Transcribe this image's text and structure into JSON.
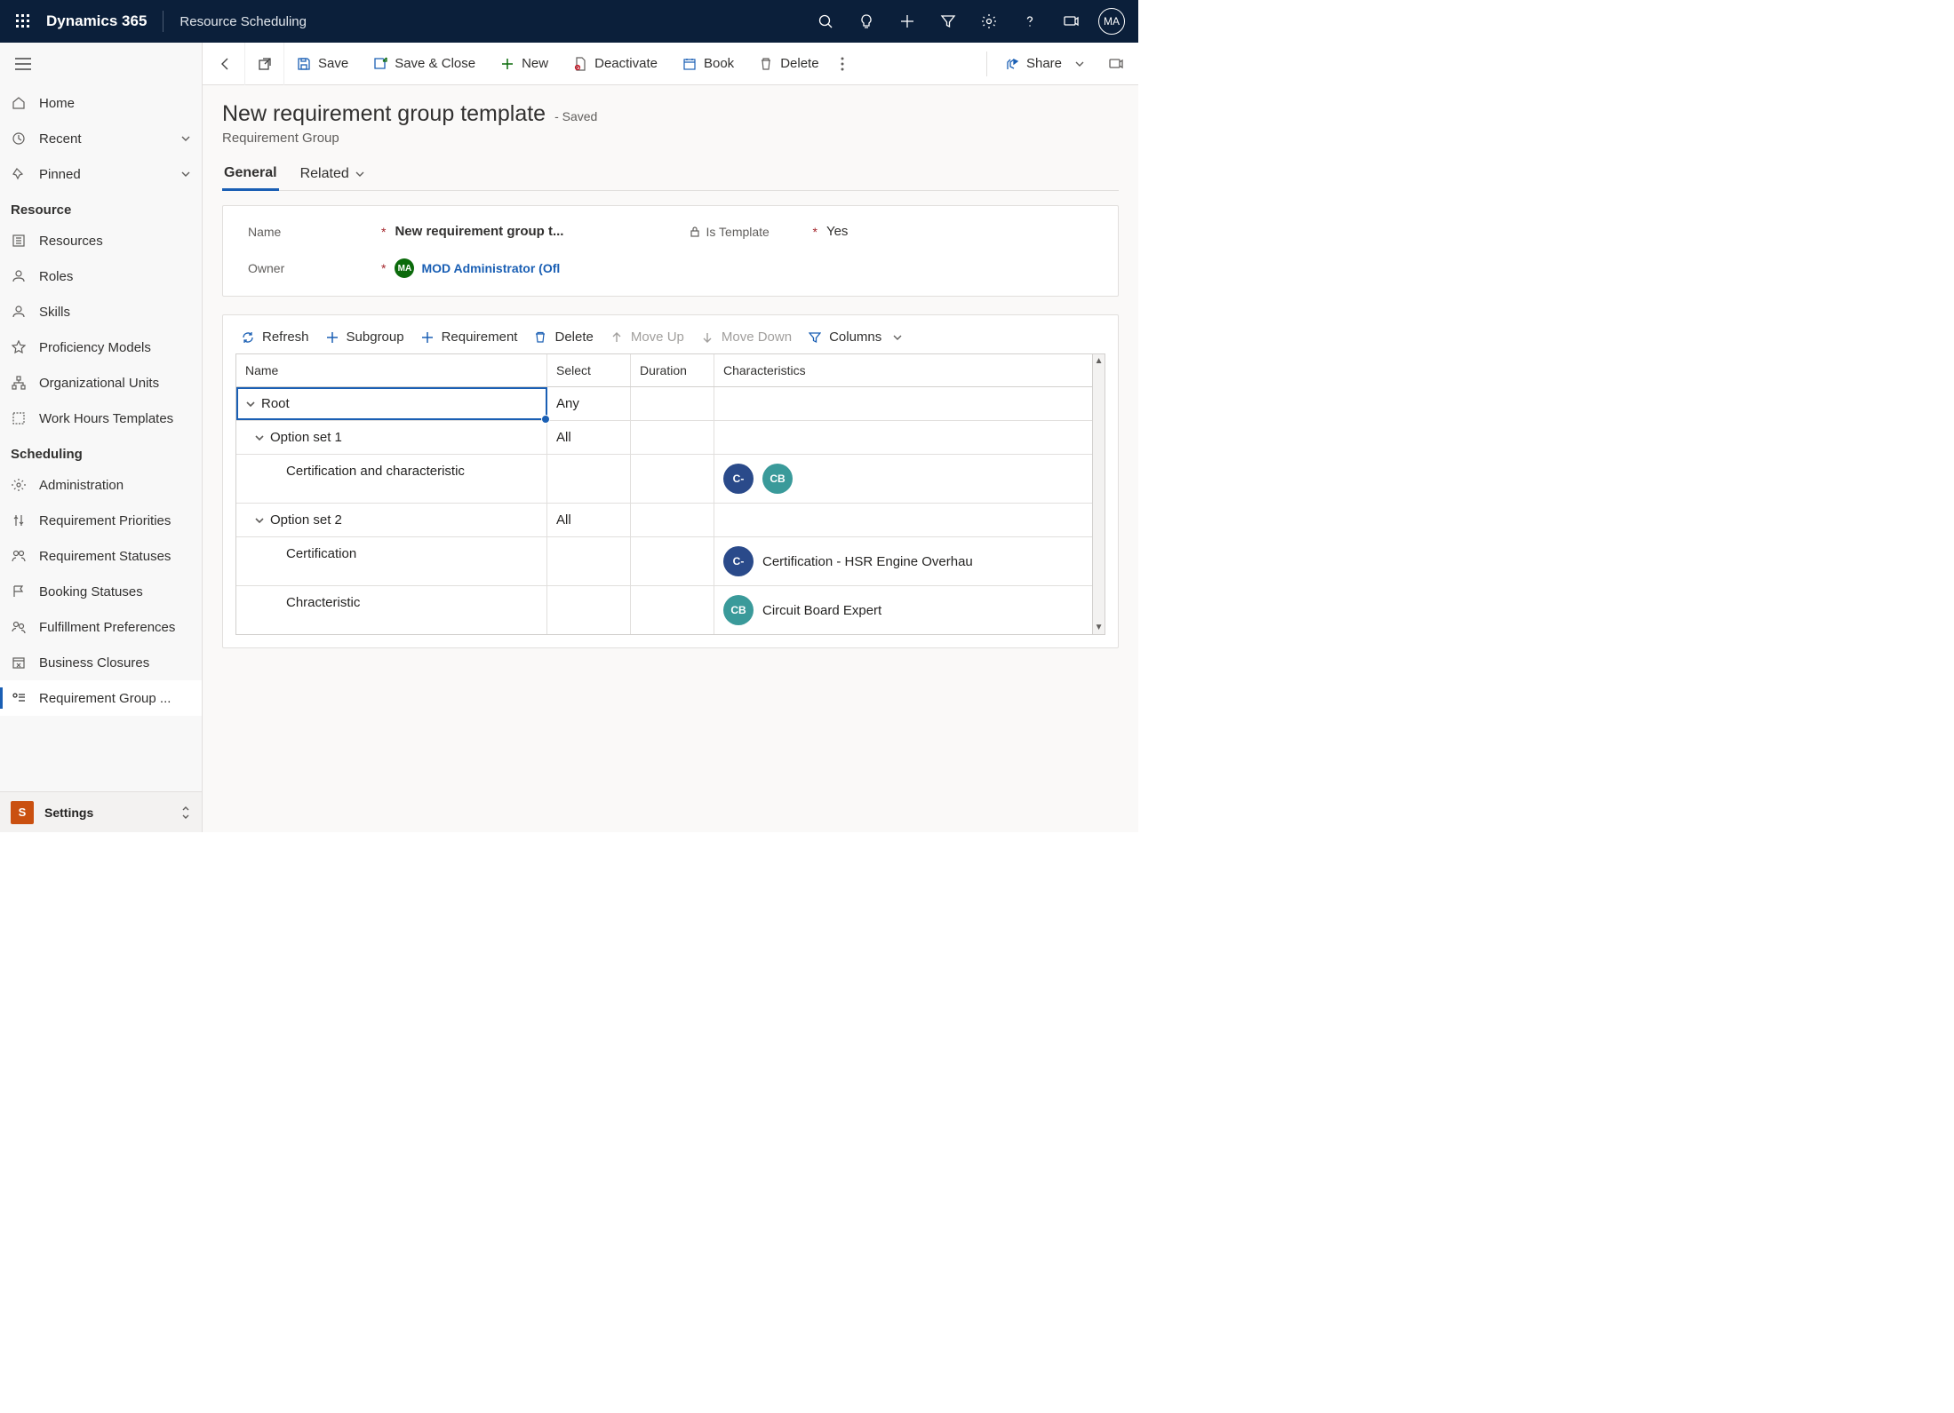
{
  "topbar": {
    "brand": "Dynamics 365",
    "app": "Resource Scheduling",
    "avatar": "MA"
  },
  "nav": {
    "home": "Home",
    "recent": "Recent",
    "pinned": "Pinned",
    "section_resource": "Resource",
    "resources": "Resources",
    "roles": "Roles",
    "skills": "Skills",
    "proficiency": "Proficiency Models",
    "org_units": "Organizational Units",
    "work_hours": "Work Hours Templates",
    "section_scheduling": "Scheduling",
    "administration": "Administration",
    "req_priorities": "Requirement Priorities",
    "req_statuses": "Requirement Statuses",
    "booking_statuses": "Booking Statuses",
    "fulfillment": "Fulfillment Preferences",
    "biz_closures": "Business Closures",
    "req_group": "Requirement Group ...",
    "area_badge": "S",
    "area_label": "Settings"
  },
  "cmdbar": {
    "save": "Save",
    "save_close": "Save & Close",
    "new": "New",
    "deactivate": "Deactivate",
    "book": "Book",
    "delete": "Delete",
    "share": "Share"
  },
  "page": {
    "title": "New requirement group template",
    "saved_suffix": "- Saved",
    "subtitle": "Requirement Group",
    "tab_general": "General",
    "tab_related": "Related"
  },
  "form": {
    "name_label": "Name",
    "name_value": "New requirement group t...",
    "template_label": "Is Template",
    "template_value": "Yes",
    "owner_label": "Owner",
    "owner_value": "MOD Administrator (Ofl",
    "owner_initials": "MA"
  },
  "grid_toolbar": {
    "refresh": "Refresh",
    "subgroup": "Subgroup",
    "requirement": "Requirement",
    "delete": "Delete",
    "move_up": "Move Up",
    "move_down": "Move Down",
    "columns": "Columns"
  },
  "grid": {
    "headers": {
      "name": "Name",
      "select": "Select",
      "duration": "Duration",
      "characteristics": "Characteristics"
    },
    "rows": [
      {
        "name": "Root",
        "select": "Any",
        "duration": "",
        "indent": 0,
        "expandable": true,
        "selected": true,
        "chars": []
      },
      {
        "name": "Option set 1",
        "select": "All",
        "duration": "",
        "indent": 1,
        "expandable": true,
        "chars": []
      },
      {
        "name": "Certification and characteristic",
        "select": "",
        "duration": "",
        "indent": 2,
        "chars": [
          {
            "code": "C-",
            "color": "blue"
          },
          {
            "code": "CB",
            "color": "teal"
          }
        ]
      },
      {
        "name": "Option set 2",
        "select": "All",
        "duration": "",
        "indent": 1,
        "expandable": true,
        "chars": []
      },
      {
        "name": "Certification",
        "select": "",
        "duration": "",
        "indent": 2,
        "chars": [
          {
            "code": "C-",
            "color": "blue",
            "text": "Certification - HSR Engine Overhau"
          }
        ]
      },
      {
        "name": "Chracteristic",
        "select": "",
        "duration": "",
        "indent": 2,
        "chars": [
          {
            "code": "CB",
            "color": "teal",
            "text": "Circuit Board Expert"
          }
        ]
      }
    ]
  }
}
